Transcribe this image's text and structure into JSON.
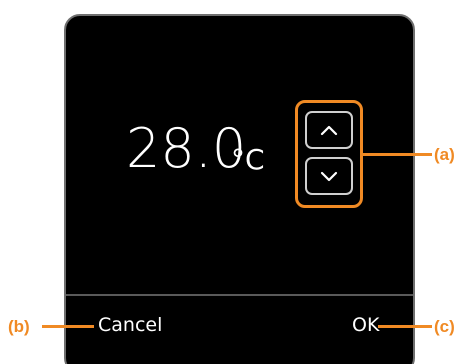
{
  "temperature": {
    "value": "28.0",
    "unit": "°C"
  },
  "stepper": {
    "up_icon": "chevron-up-icon",
    "down_icon": "chevron-down-icon"
  },
  "footer": {
    "cancel_label": "Cancel",
    "ok_label": "OK"
  },
  "callouts": {
    "a": "(a)",
    "b": "(b)",
    "c": "(c)"
  },
  "colors": {
    "screen_bg": "#000000",
    "highlight": "#f08a24",
    "text": "#ffffff"
  }
}
